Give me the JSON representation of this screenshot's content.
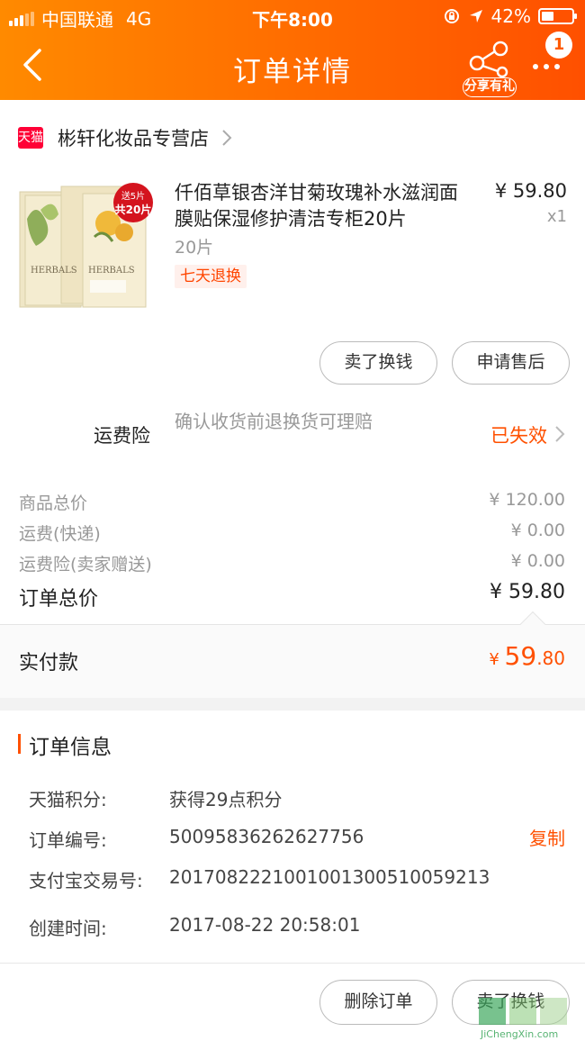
{
  "status_bar": {
    "carrier": "中国联通",
    "network": "4G",
    "time": "下午8:00",
    "battery": "42%",
    "battery_level": 0.42
  },
  "nav": {
    "title": "订单详情",
    "share_label": "分享有礼",
    "badge": "1"
  },
  "shop": {
    "logo_text": "天猫",
    "name": "彬轩化妆品专营店"
  },
  "product": {
    "title": "仟佰草银杏洋甘菊玫瑰补水滋润面膜贴保湿修护清洁专柜20片",
    "price": "¥ 59.80",
    "quantity": "x1",
    "sku": "20片",
    "tag": "七天退换",
    "image_promo_top": "送5片",
    "image_promo_bottom": "共20片",
    "image_brand": "HERBALS"
  },
  "actions": {
    "sell_exchange": "卖了换钱",
    "after_sale": "申请售后"
  },
  "insurance": {
    "label": "运费险",
    "desc": "确认收货前退换货可理赔",
    "status": "已失效"
  },
  "fees": [
    {
      "label": "商品总价",
      "value": "¥ 120.00"
    },
    {
      "label": "运费(快递)",
      "value": "¥ 0.00"
    },
    {
      "label": "运费险(卖家赠送)",
      "value": "¥ 0.00"
    }
  ],
  "total": {
    "label": "订单总价",
    "value": "¥ 59.80"
  },
  "paid": {
    "label": "实付款",
    "currency": "¥ ",
    "int": "59",
    "dec": ".80"
  },
  "order_info": {
    "title": "订单信息",
    "rows": [
      {
        "label": "天猫积分:",
        "value": "获得29点积分"
      },
      {
        "label": "订单编号:",
        "value": "500958362626277​56"
      },
      {
        "label": "支付宝交易号:",
        "value": "2017082221001001300510059213"
      },
      {
        "label": "创建时间:",
        "value": "2017-08-22 20:58:01"
      }
    ],
    "copy_label": "复制"
  },
  "bottom_bar": {
    "delete_order": "删除订单",
    "sell_exchange": "卖了换钱"
  },
  "watermark": {
    "text": "JiChengXin.com"
  },
  "colors": {
    "accent": "#ff5000",
    "header_start": "#ff8a00",
    "tmall_red": "#ff0036"
  }
}
